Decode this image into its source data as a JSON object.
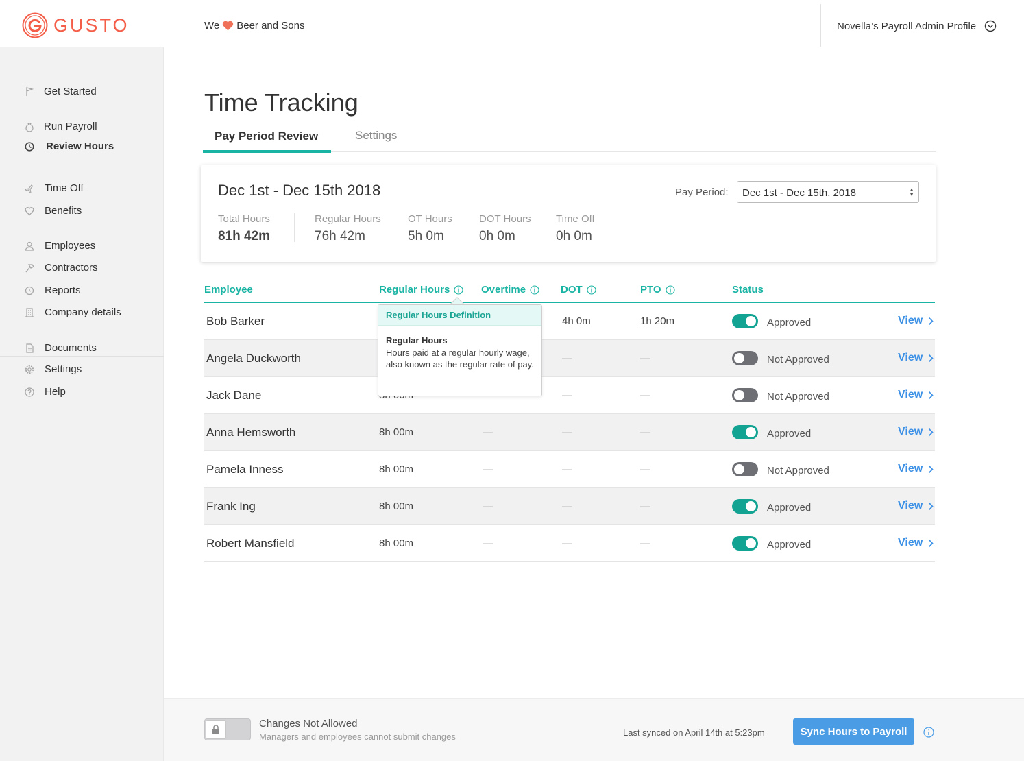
{
  "header": {
    "logo_text": "GUSTO",
    "company_prefix": "We",
    "company_name": "Beer and Sons",
    "profile_name": "Novella’s Payroll Admin Profile",
    "brand_color": "#f45d48"
  },
  "sidebar": {
    "items": [
      {
        "label": "Get Started",
        "icon": "flag-icon"
      },
      {
        "label": "Run Payroll",
        "icon": "money-bag-icon"
      },
      {
        "label": "Review Hours",
        "icon": "clock-icon",
        "active": true
      },
      {
        "label": "Time Off",
        "icon": "airplane-icon"
      },
      {
        "label": "Benefits",
        "icon": "heart-icon"
      },
      {
        "label": "Employees",
        "icon": "person-icon"
      },
      {
        "label": "Contractors",
        "icon": "hammer-icon"
      },
      {
        "label": "Reports",
        "icon": "clock-icon"
      },
      {
        "label": "Company details",
        "icon": "building-icon"
      },
      {
        "label": "Documents",
        "icon": "document-icon"
      },
      {
        "label": "Settings",
        "icon": "gear-icon"
      },
      {
        "label": "Help",
        "icon": "help-icon"
      }
    ]
  },
  "main": {
    "title": "Time Tracking",
    "tabs": [
      {
        "label": "Pay Period Review",
        "active": true
      },
      {
        "label": "Settings",
        "active": false
      }
    ],
    "summary": {
      "title": "Dec 1st - Dec 15th 2018",
      "pay_period_label": "Pay Period:",
      "pay_period_value": "Dec 1st - Dec 15th, 2018",
      "stats": [
        {
          "label": "Total Hours",
          "value": "81h 42m"
        },
        {
          "label": "Regular Hours",
          "value": "76h 42m"
        },
        {
          "label": "OT Hours",
          "value": "5h 0m"
        },
        {
          "label": "DOT Hours",
          "value": "0h 0m"
        },
        {
          "label": "Time Off",
          "value": "0h 0m"
        }
      ]
    },
    "table": {
      "columns": [
        "Employee",
        "Regular Hours",
        "Overtime",
        "DOT",
        "PTO",
        "Status"
      ],
      "view_label": "View",
      "rows": [
        {
          "name": "Bob Barker",
          "regular": "",
          "overtime": "",
          "dot": "4h 0m",
          "pto": "1h 20m",
          "status": "Approved",
          "approved": true
        },
        {
          "name": "Angela Duckworth",
          "regular": "",
          "overtime": "",
          "dot": "—",
          "pto": "—",
          "status": "Not Approved",
          "approved": false
        },
        {
          "name": "Jack Dane",
          "regular": "8h 00m",
          "overtime": "",
          "dot": "—",
          "pto": "—",
          "status": "Not Approved",
          "approved": false
        },
        {
          "name": "Anna Hemsworth",
          "regular": "8h 00m",
          "overtime": "—",
          "dot": "—",
          "pto": "—",
          "status": "Approved",
          "approved": true
        },
        {
          "name": "Pamela Inness",
          "regular": "8h 00m",
          "overtime": "—",
          "dot": "—",
          "pto": "—",
          "status": "Not Approved",
          "approved": false
        },
        {
          "name": "Frank Ing",
          "regular": "8h 00m",
          "overtime": "—",
          "dot": "—",
          "pto": "—",
          "status": "Approved",
          "approved": true
        },
        {
          "name": "Robert Mansfield",
          "regular": "8h 00m",
          "overtime": "—",
          "dot": "—",
          "pto": "—",
          "status": "Approved",
          "approved": true
        }
      ]
    },
    "tooltip": {
      "title": "Regular Hours Definition",
      "term": "Regular Hours",
      "definition": "Hours paid at a regular hourly wage, also known as the regular rate of pay."
    }
  },
  "footer": {
    "lock_title": "Changes Not Allowed",
    "lock_subtitle": "Managers and employees cannot submit changes",
    "last_synced": "Last synced on April 14th at 5:23pm",
    "sync_button": "Sync Hours to Payroll"
  },
  "colors": {
    "accent": "#1ab4a4",
    "toggle_on": "#12a393",
    "toggle_off": "#6d6f74",
    "link": "#3c91e6",
    "button": "#4a9de5"
  }
}
